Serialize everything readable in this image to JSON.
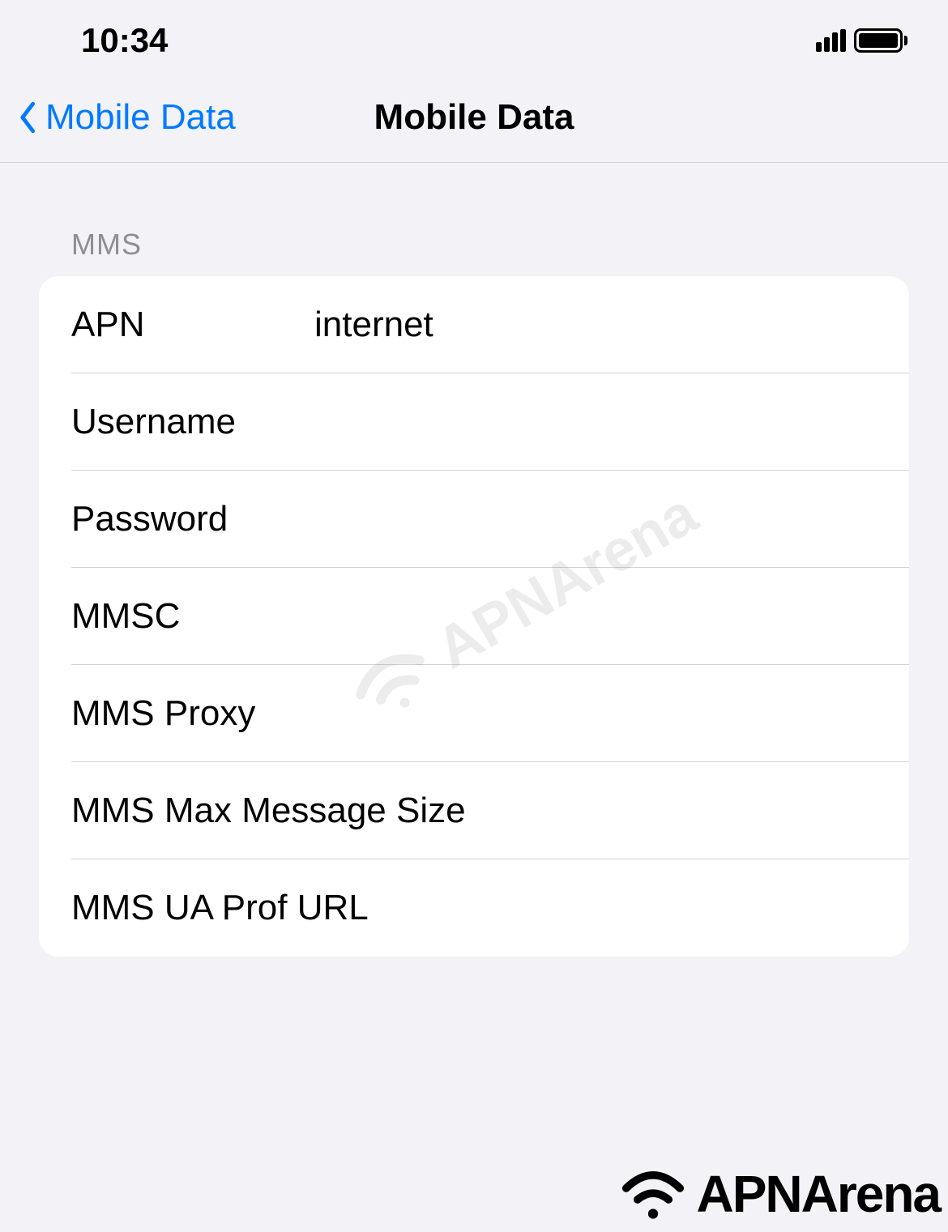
{
  "statusBar": {
    "time": "10:34"
  },
  "navBar": {
    "backLabel": "Mobile Data",
    "title": "Mobile Data"
  },
  "section": {
    "header": "MMS",
    "rows": [
      {
        "label": "APN",
        "value": "internet"
      },
      {
        "label": "Username",
        "value": ""
      },
      {
        "label": "Password",
        "value": ""
      },
      {
        "label": "MMSC",
        "value": ""
      },
      {
        "label": "MMS Proxy",
        "value": ""
      },
      {
        "label": "MMS Max Message Size",
        "value": ""
      },
      {
        "label": "MMS UA Prof URL",
        "value": ""
      }
    ]
  },
  "watermark": {
    "brand": "APNArena"
  }
}
